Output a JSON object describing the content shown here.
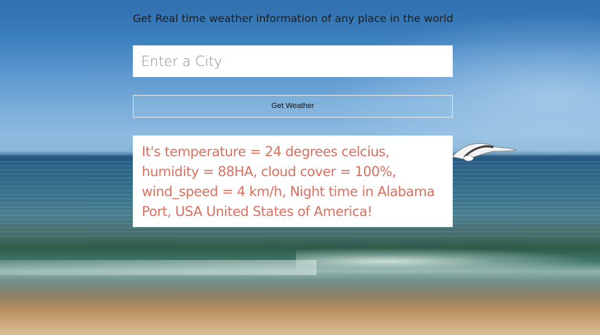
{
  "page": {
    "heading": "Get Real time weather information of any place in the world"
  },
  "search": {
    "placeholder": "Enter a City",
    "value": ""
  },
  "actions": {
    "get_weather_label": "Get Weather"
  },
  "result": {
    "text": "It's temperature = 24 degrees celcius, humidity = 88HA, cloud cover = 100%, wind_speed = 4 km/h, Night time in Alabama Port, USA United States of America!"
  },
  "theme": {
    "result_text_color": "#d9705f",
    "heading_color": "#1c1c1c"
  },
  "background": {
    "icon": "beach-seagull-photo"
  }
}
